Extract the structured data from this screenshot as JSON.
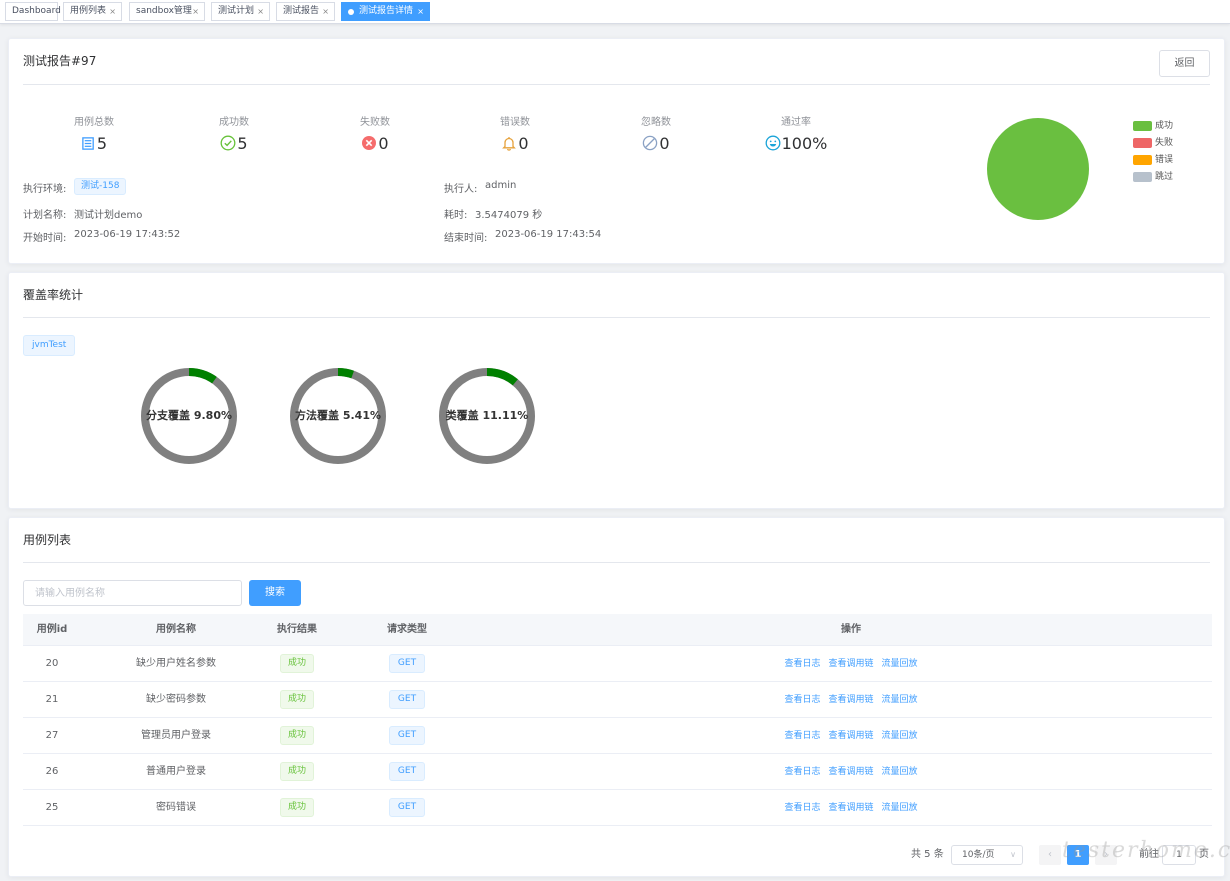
{
  "tabs": [
    {
      "label": "Dashboard",
      "close": ""
    },
    {
      "label": "用例列表",
      "close": "×"
    },
    {
      "label": "sandbox管理",
      "close": "×"
    },
    {
      "label": "测试计划",
      "close": "×"
    },
    {
      "label": "测试报告",
      "close": "×"
    },
    {
      "label": "测试报告详情",
      "close": "×"
    }
  ],
  "report": {
    "title": "测试报告#97",
    "back_label": "返回",
    "stats": [
      {
        "label": "用例总数",
        "value": "5",
        "icon": "list-icon"
      },
      {
        "label": "成功数",
        "value": "5",
        "icon": "check-circle-icon"
      },
      {
        "label": "失败数",
        "value": "0",
        "icon": "close-circle-icon"
      },
      {
        "label": "错误数",
        "value": "0",
        "icon": "bell-icon"
      },
      {
        "label": "忽略数",
        "value": "0",
        "icon": "forbidden-icon"
      },
      {
        "label": "通过率",
        "value": "100%",
        "icon": "smile-icon"
      }
    ],
    "info": {
      "env_label": "执行环境:",
      "env_value": "测试-158",
      "executor_label": "执行人:",
      "executor_value": "admin",
      "plan_label": "计划名称:",
      "plan_value": "测试计划demo",
      "duration_label": "耗时:",
      "duration_value": "3.5474079 秒",
      "start_label": "开始时间:",
      "start_value": "2023-06-19 17:43:52",
      "end_label": "结束时间:",
      "end_value": "2023-06-19 17:43:54"
    },
    "pie": {
      "slices": [
        {
          "name": "成功",
          "value": 5,
          "color": "#6abf40"
        },
        {
          "name": "失败",
          "value": 0,
          "color": "#ee6666"
        },
        {
          "name": "错误",
          "value": 0,
          "color": "#ffa500"
        },
        {
          "name": "跳过",
          "value": 0,
          "color": "#b7c1cc"
        }
      ]
    }
  },
  "coverage": {
    "title": "覆盖率统计",
    "tag": "jvmTest",
    "rings": [
      {
        "label": "分支覆盖 9.80%",
        "fraction": 0.098
      },
      {
        "label": "方法覆盖 5.41%",
        "fraction": 0.0541
      },
      {
        "label": "类覆盖 11.11%",
        "fraction": 0.1111
      }
    ],
    "ring_color": "#808080",
    "ring_fill_color": "#008000"
  },
  "cases": {
    "title": "用例列表",
    "search_placeholder": "请输入用例名称",
    "search_label": "搜索",
    "columns": [
      "用例id",
      "用例名称",
      "执行结果",
      "请求类型",
      "操作"
    ],
    "rows": [
      {
        "id": "20",
        "name": "缺少用户姓名参数",
        "result": "成功",
        "type": "GET"
      },
      {
        "id": "21",
        "name": "缺少密码参数",
        "result": "成功",
        "type": "GET"
      },
      {
        "id": "27",
        "name": "管理员用户登录",
        "result": "成功",
        "type": "GET"
      },
      {
        "id": "26",
        "name": "普通用户登录",
        "result": "成功",
        "type": "GET"
      },
      {
        "id": "25",
        "name": "密码错误",
        "result": "成功",
        "type": "GET"
      }
    ],
    "actions": [
      "查看日志",
      "查看调用链",
      "流量回放"
    ],
    "pagination": {
      "total": "共 5 条",
      "page_size": "10条/页",
      "current": "1",
      "goto_label": "前往",
      "goto_value": "1",
      "page_suffix": "页"
    }
  },
  "watermark": "testerhome.com"
}
